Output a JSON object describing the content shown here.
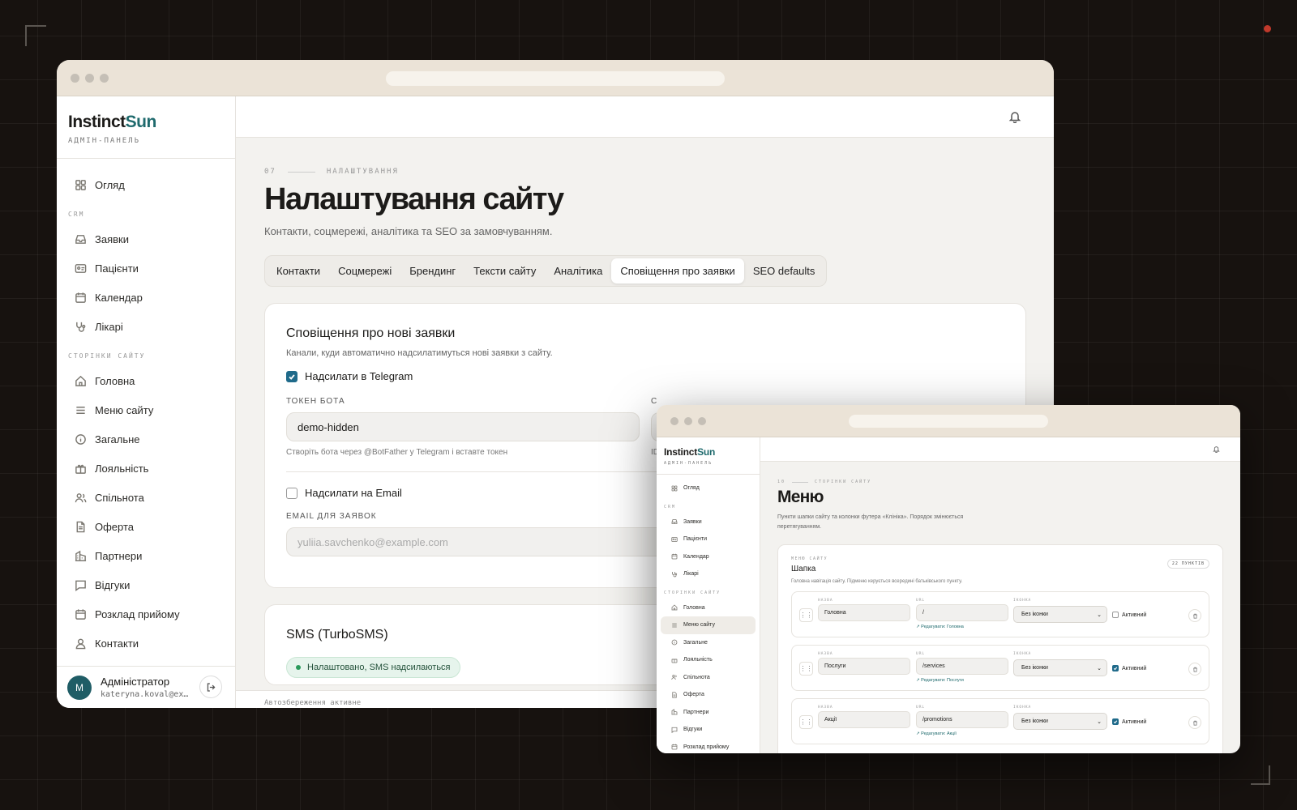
{
  "main_window": {
    "brand": {
      "name_part1": "Instinct",
      "name_part2": "Sun",
      "subtitle": "АДМІН-ПАНЕЛЬ"
    },
    "nav": {
      "overview": "Огляд",
      "crm_section": "CRM",
      "requests": "Заявки",
      "patients": "Пацієнти",
      "calendar": "Календар",
      "doctors": "Лікарі",
      "pages_section": "СТОРІНКИ САЙТУ",
      "home": "Головна",
      "site_menu": "Меню сайту",
      "general": "Загальне",
      "loyalty": "Лояльність",
      "community": "Спільнота",
      "offer": "Оферта",
      "partners": "Партнери",
      "reviews": "Відгуки",
      "schedule": "Розклад прийому",
      "contacts": "Контакти"
    },
    "user": {
      "initial": "M",
      "name": "Адміністратор",
      "email": "kateryna.koval@ex…"
    },
    "page": {
      "number": "07",
      "section": "НАЛАШТУВАННЯ",
      "title": "Налаштування сайту",
      "subtitle": "Контакти, соцмережі, аналітика та SEO за замовчуванням."
    },
    "tabs": [
      "Контакти",
      "Соцмережі",
      "Брендинг",
      "Тексти сайту",
      "Аналітика",
      "Сповіщення про заявки",
      "SEO defaults"
    ],
    "active_tab": "Сповіщення про заявки",
    "notifications_card": {
      "title": "Сповіщення про нові заявки",
      "description": "Канали, куди автоматично надсилатимуться нові заявки з сайту.",
      "telegram_checkbox": "Надсилати в Telegram",
      "telegram_checked": true,
      "token_label": "ТОКЕН БОТА",
      "token_value": "demo-hidden",
      "token_hint": "Створіть бота через @BotFather у Telegram і вставте токен",
      "chat_label_partial": "С",
      "chat_hint_partial": "ID",
      "email_checkbox": "Надсилати на Email",
      "email_checked": false,
      "email_label": "EMAIL ДЛЯ ЗАЯВОК",
      "email_placeholder": "yuliia.savchenko@example.com"
    },
    "sms_card": {
      "title": "SMS (TurboSMS)",
      "status": "Налаштовано, SMS надсилаються"
    },
    "autosave": "Автозбереження активне"
  },
  "second_window": {
    "brand": {
      "name_part1": "Instinct",
      "name_part2": "Sun",
      "subtitle": "АДМІН-ПАНЕЛЬ"
    },
    "nav": {
      "overview": "Огляд",
      "crm_section": "CRM",
      "requests": "Заявки",
      "patients": "Пацієнти",
      "calendar": "Календар",
      "doctors": "Лікарі",
      "pages_section": "СТОРІНКИ САЙТУ",
      "home": "Головна",
      "site_menu": "Меню сайту",
      "general": "Загальне",
      "loyalty": "Лояльність",
      "community": "Спільнота",
      "offer": "Оферта",
      "partners": "Партнери",
      "reviews": "Відгуки",
      "schedule": "Розклад прийому"
    },
    "page": {
      "number": "10",
      "section": "СТОРІНКИ САЙТУ",
      "title": "Меню",
      "subtitle": "Пункти шапки сайту та колонки футера «Клініка». Порядок змінюється перетягуванням."
    },
    "menu_card": {
      "eyebrow": "МЕНЮ САЙТУ",
      "title": "Шапка",
      "description": "Головна навігація сайту. Підменю керується всередині батьківського пункту.",
      "count": "22 ПУНКТІВ",
      "col_name": "НАЗВА",
      "col_url": "URL",
      "col_icon": "ІКОНКА",
      "active_label": "Активний",
      "rows": [
        {
          "name": "Головна",
          "url": "/",
          "edit": "↗ Редагувати: Головна",
          "icon": "Без іконки",
          "active": false
        },
        {
          "name": "Послуги",
          "url": "/services",
          "edit": "↗ Редагувати: Послуги",
          "icon": "Без іконки",
          "active": true
        },
        {
          "name": "Акції",
          "url": "/promotions",
          "edit": "↗ Редагувати: Акції",
          "icon": "Без іконки",
          "active": true
        }
      ]
    }
  }
}
